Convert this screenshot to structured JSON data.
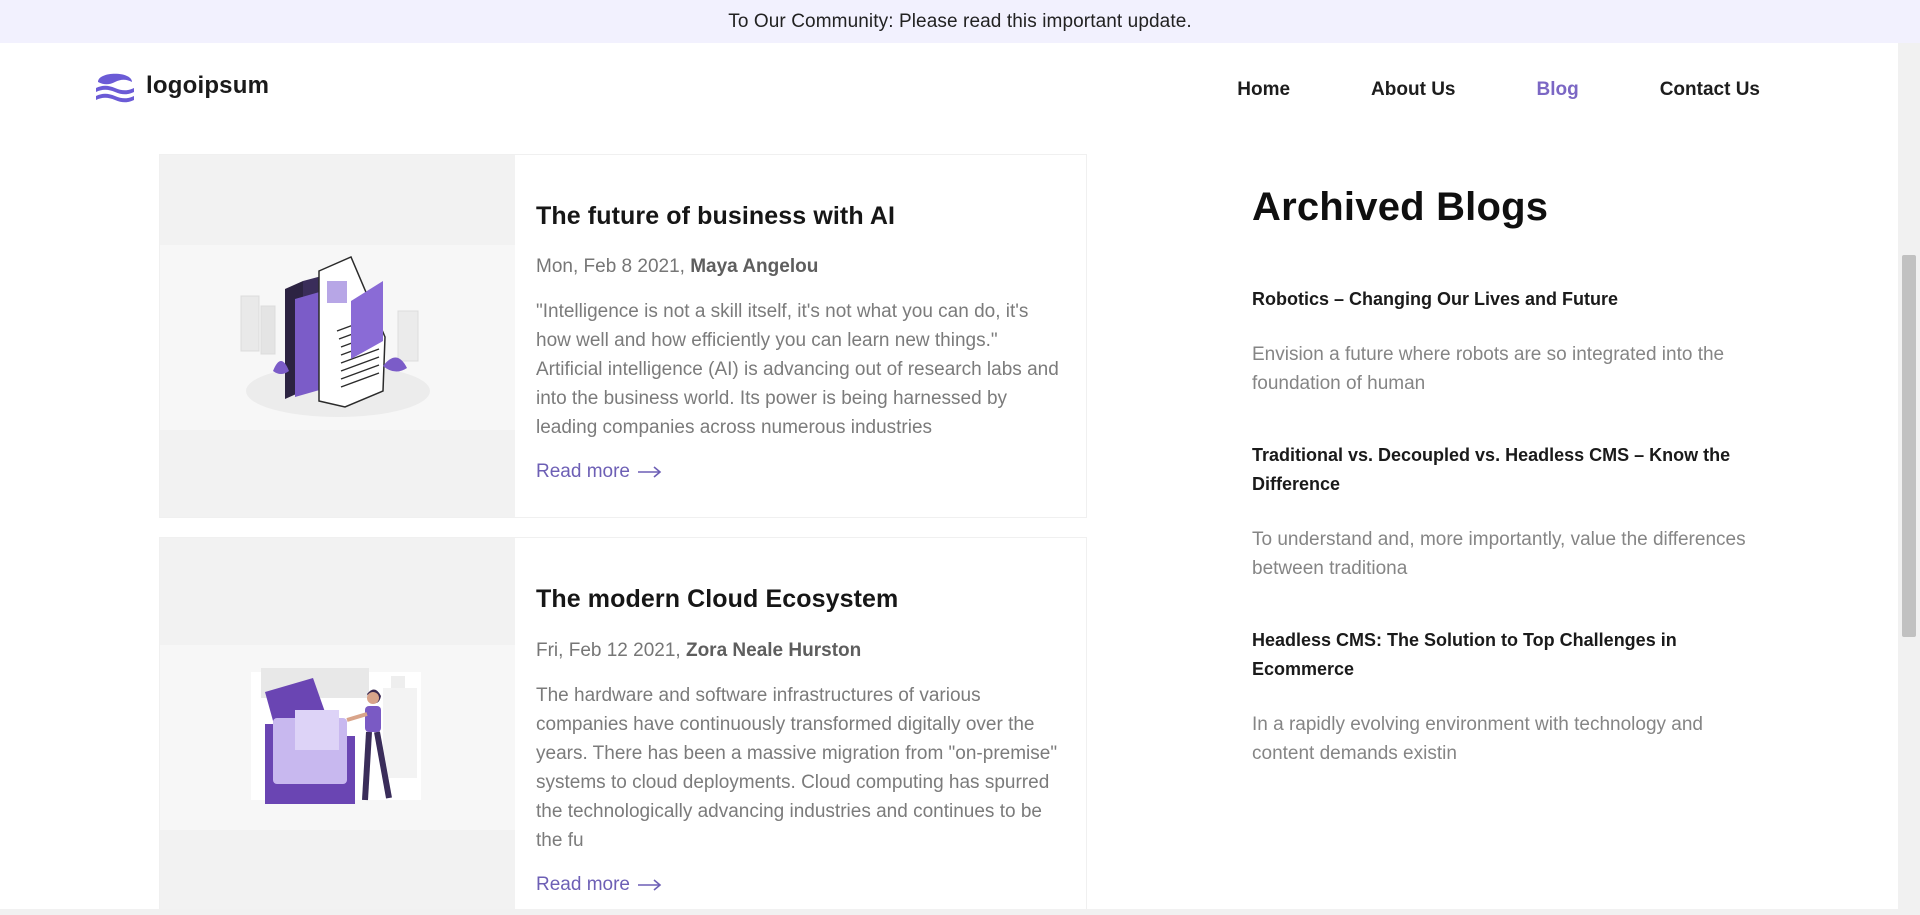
{
  "announcement": "To Our Community: Please read this important update.",
  "brand": {
    "name": "logoipsum",
    "accent": "#6b5bd6",
    "logo_icon": "waves-icon"
  },
  "nav": {
    "items": [
      {
        "label": "Home",
        "active": false
      },
      {
        "label": "About Us",
        "active": false
      },
      {
        "label": "Blog",
        "active": true
      },
      {
        "label": "Contact Us",
        "active": false
      }
    ],
    "active_color": "#7b67c4"
  },
  "posts": [
    {
      "title": "The future of business with AI",
      "date": "Mon, Feb 8 2021,",
      "author": "Maya Angelou",
      "excerpt": "\"Intelligence is not a skill itself, it's not what you can do, it's how well and how efficiently you can learn new things.\" Artificial intelligence (AI) is advancing out of research labs and into the business world. Its power is being harnessed by leading companies across numerous industries",
      "read_more": "Read more",
      "image_icon": "ai-documents-illustration"
    },
    {
      "title": "The modern Cloud Ecosystem",
      "date": "Fri, Feb 12 2021,",
      "author": "Zora Neale Hurston",
      "excerpt": "The hardware and software infrastructures of various companies have continuously transformed digitally over the years. There has been a massive migration from \"on-premise\" systems to cloud deployments. Cloud computing has spurred the technologically advancing industries and continues to be the fu",
      "read_more": "Read more",
      "image_icon": "cloud-folder-illustration"
    }
  ],
  "archive": {
    "heading": "Archived Blogs",
    "items": [
      {
        "title": "Robotics – Changing Our Lives and Future",
        "excerpt": "Envision a future where robots are so integrated into the foundation of human"
      },
      {
        "title": "Traditional vs. Decoupled vs. Headless CMS – Know the Difference",
        "excerpt": "To understand and, more importantly, value the differences between traditiona"
      },
      {
        "title": "Headless CMS: The Solution to Top Challenges in Ecommerce",
        "excerpt": "In a rapidly evolving environment with technology and content demands existin"
      }
    ]
  }
}
